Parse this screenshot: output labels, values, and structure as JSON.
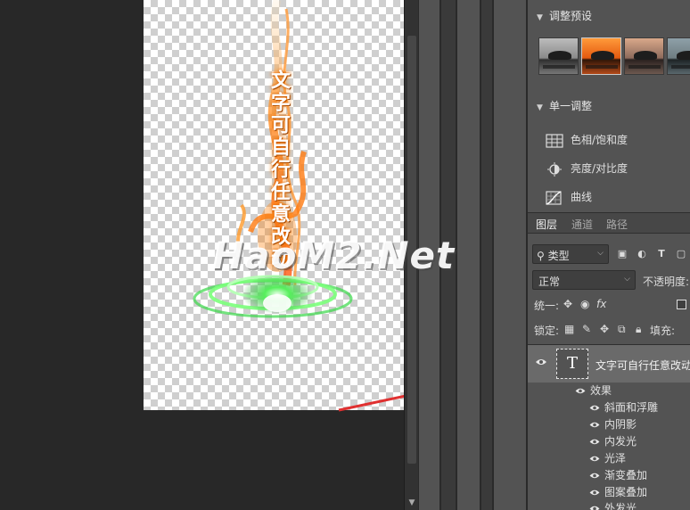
{
  "canvas": {
    "vertical_text": "文字可自行任意改动"
  },
  "watermark": "HaoM2.Net",
  "panel": {
    "presets_title": "调整预设",
    "single_title": "单一调整",
    "adjustments": [
      "色相/饱和度",
      "亮度/对比度",
      "曲线"
    ],
    "tabs": [
      "图层",
      "通道",
      "路径"
    ],
    "filter_kind": "类型",
    "blend_mode": "正常",
    "opacity_label": "不透明度:",
    "unify_label": "统一:",
    "lock_label": "锁定:",
    "fill_label": "填充:",
    "layer": {
      "thumb_glyph": "T",
      "name": "文字可自行任意改动",
      "effects_label": "效果",
      "effects": [
        "斜面和浮雕",
        "内阴影",
        "内发光",
        "光泽",
        "渐变叠加",
        "图案叠加",
        "外发光"
      ]
    }
  },
  "colors": {
    "panel_bg": "#535353",
    "workspace_bg": "#282828",
    "arrow_red": "#e03030",
    "fire_orange": "#ff8a00",
    "ring_green": "#3ee04a"
  }
}
